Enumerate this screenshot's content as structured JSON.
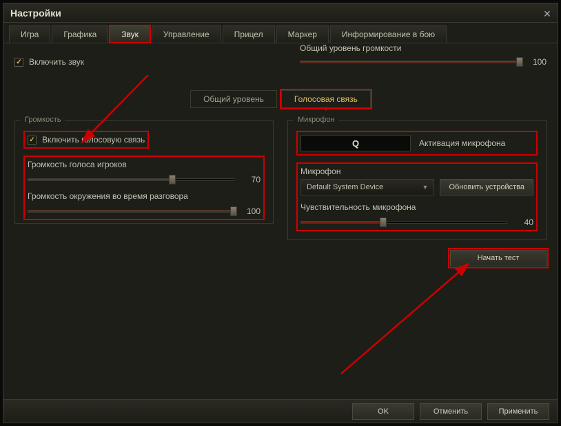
{
  "window": {
    "title": "Настройки"
  },
  "tabs": [
    "Игра",
    "Графика",
    "Звук",
    "Управление",
    "Прицел",
    "Маркер",
    "Информирование в бою"
  ],
  "active_tab_index": 2,
  "enable_sound": {
    "label": "Включить звук",
    "checked": true
  },
  "master_volume": {
    "label": "Общий уровень громкости",
    "value": 100
  },
  "subtabs": {
    "general": "Общий уровень",
    "voice": "Голосовая связь",
    "active": "voice"
  },
  "volume_section": {
    "title": "Громкость",
    "enable_voice": {
      "label": "Включить голосовую связь",
      "checked": true
    },
    "player_voice": {
      "label": "Громкость голоса игроков",
      "value": 70
    },
    "ambient": {
      "label": "Громкость окружения во время разговора",
      "value": 100
    }
  },
  "mic_section": {
    "title": "Микрофон",
    "keybind": {
      "key": "Q",
      "label": "Активация микрофона"
    },
    "device_label": "Микрофон",
    "device_selected": "Default System Device",
    "refresh_btn": "Обновить устройства",
    "sensitivity": {
      "label": "Чувствительность микрофона",
      "value": 40
    },
    "test_btn": "Начать тест"
  },
  "footer": {
    "ok": "OK",
    "cancel": "Отменить",
    "apply": "Применить"
  }
}
